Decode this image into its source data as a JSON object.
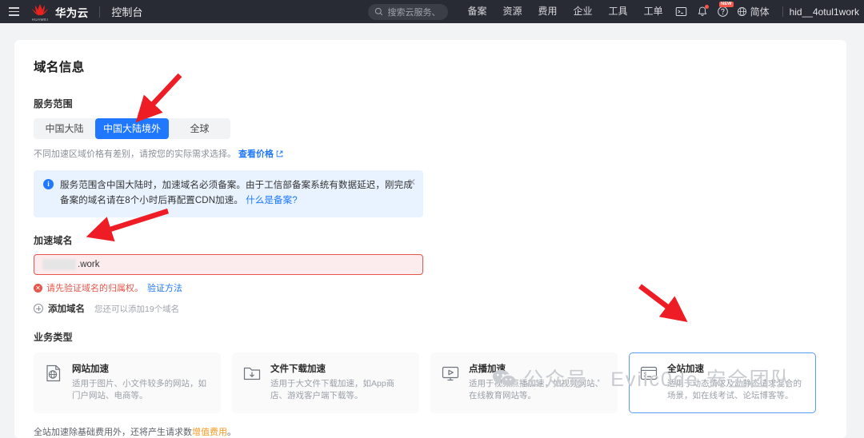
{
  "topbar": {
    "menu_icon": "hamburger-icon",
    "brand": "华为云",
    "brand_logo_text": "HUAWEI",
    "console": "控制台",
    "search_placeholder": "搜索云服务、",
    "search_icon": "search-icon",
    "nav_items": [
      "备案",
      "资源",
      "费用",
      "企业",
      "工具",
      "工单"
    ],
    "cloudshell_icon": "terminal-icon",
    "notification_icon": "bell-icon",
    "help_icon": "help-circle-icon",
    "help_badge": "NEW",
    "language_icon": "globe-icon",
    "language": "简体",
    "user": "hid__4otul1work"
  },
  "main": {
    "title": "域名信息",
    "service_scope": {
      "label": "服务范围",
      "options": [
        "中国大陆",
        "中国大陆境外",
        "全球"
      ],
      "selected": "中国大陆境外",
      "hint_prefix": "不同加速区域价格有差别，请按您的实际需求选择。",
      "hint_link": "查看价格",
      "external_icon": "external-link-icon"
    },
    "alert": {
      "icon": "info-icon",
      "line1": "服务范围含中国大陆时，加速域名必须备案。由于工信部备案系统有数据延迟，刚完成",
      "line2": "备案的域名请在8个小时后再配置CDN加速。",
      "link": "什么是备案?",
      "close_icon": "close-icon"
    },
    "domain": {
      "label": "加速域名",
      "value": ".work",
      "masked": true,
      "error_icon": "error-circle-icon",
      "error_text": "请先验证域名的归属权。",
      "error_link": "验证方法",
      "add_icon": "plus-circle-icon",
      "add_label": "添加域名",
      "add_hint": "您还可以添加19个域名"
    },
    "business_type": {
      "label": "业务类型",
      "cards": [
        {
          "icon": "website-globe-doc-icon",
          "title": "网站加速",
          "desc": "适用于图片、小文件较多的网站，如门户网站、电商等。",
          "selected": false
        },
        {
          "icon": "folder-download-icon",
          "title": "文件下载加速",
          "desc": "适用于大文件下载加速，如App商店、游戏客户端下载等。",
          "selected": false
        },
        {
          "icon": "video-play-monitor-icon",
          "title": "点播加速",
          "desc": "适用于视频点播加速，如视频网站、在线教育网站等。",
          "selected": false
        },
        {
          "icon": "console-terminal-icon",
          "title": "全站加速",
          "desc": "适用于动态请求及动静态请求混合的场景，如在线考试、论坛博客等。",
          "selected": true
        }
      ]
    },
    "bottom_note": {
      "prefix": "全站加速除基础费用外，还将产生请求数",
      "highlight": "增值费用",
      "suffix": "。"
    }
  },
  "watermark": {
    "icon": "wechat-icon",
    "text": "公众号 · Evilc0de 安全团队"
  },
  "colors": {
    "topbar_bg": "#282b33",
    "accent_blue": "#1f78ff",
    "error_red": "#e8554a",
    "orange": "#f59a23",
    "annotation_red": "#ee1c25",
    "alert_bg": "#e8f3ff",
    "card_bg": "#fafafa",
    "page_bg": "#f2f3f5"
  }
}
